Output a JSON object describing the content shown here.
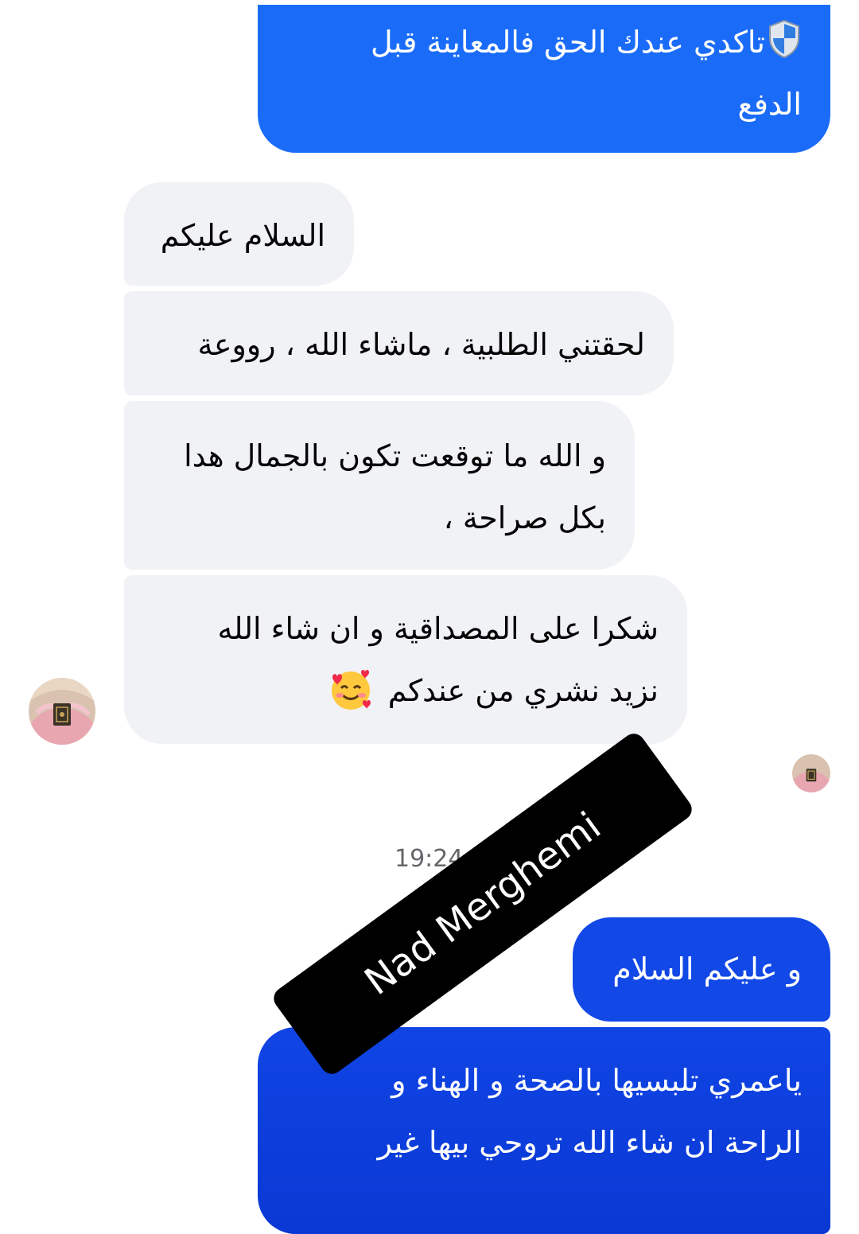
{
  "messages": [
    {
      "direction": "outgoing",
      "lines": [
        "تاكدي عندك الحق فالمعاينة قبل",
        "الدفع"
      ],
      "leading_icon": "shield-icon"
    },
    {
      "direction": "incoming",
      "lines": [
        "السلام عليكم"
      ]
    },
    {
      "direction": "incoming",
      "lines": [
        "لحقتني الطلبية ، ماشاء الله ، رووعة"
      ]
    },
    {
      "direction": "incoming",
      "lines": [
        "و الله ما توقعت تكون بالجمال هدا",
        "بكل صراحة ،"
      ]
    },
    {
      "direction": "incoming",
      "lines": [
        "شكرا على المصداقية و ان شاء الله",
        "نزيد نشري من عندكم"
      ],
      "trailing_icon": "smiling-face-with-hearts-icon"
    },
    {
      "direction": "outgoing",
      "lines": [
        "و عليكم السلام"
      ]
    },
    {
      "direction": "outgoing",
      "lines": [
        "ياعمري تلبسيها بالصحة و الهناء و",
        "الراحة ان شاء الله تروحي بيها غير"
      ]
    }
  ],
  "timestamp": "19:24",
  "watermark": "Nad Merghemi",
  "colors": {
    "outgoing_bubble": "#1a6cf8",
    "outgoing_bubble_late": "#1248e6",
    "incoming_bubble": "#f1f2f6",
    "watermark_bg": "#000000",
    "timestamp_text": "#65676b"
  },
  "avatars": [
    "contact-avatar",
    "read-receipt-avatar"
  ]
}
